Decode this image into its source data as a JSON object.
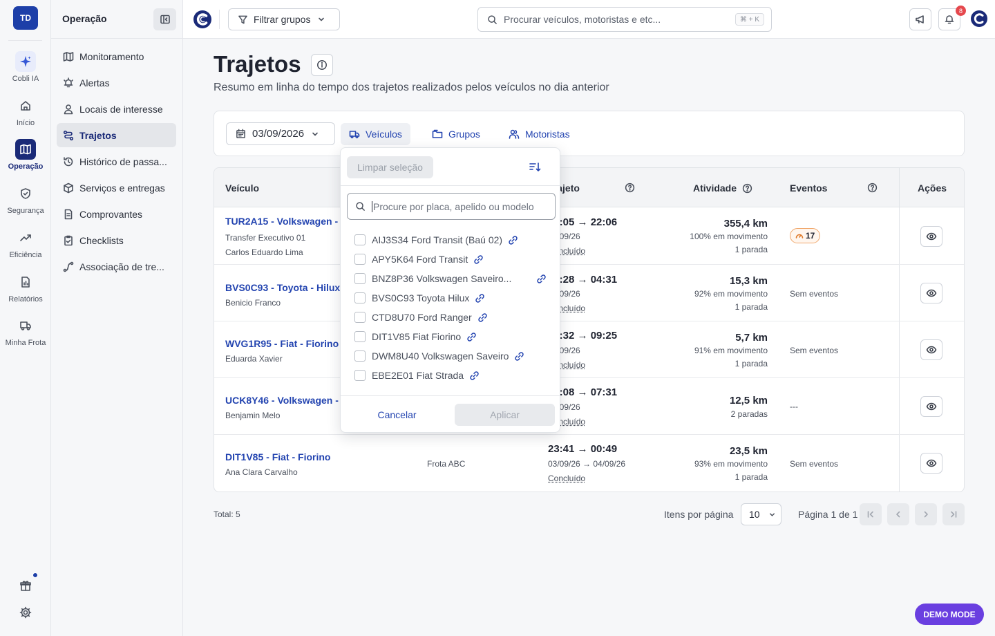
{
  "rail": {
    "avatar": "TD",
    "items": [
      {
        "label": "Cobli IA",
        "icon": "sparkles-icon"
      },
      {
        "label": "Início",
        "icon": "home-icon"
      },
      {
        "label": "Operação",
        "icon": "map-icon"
      },
      {
        "label": "Segurança",
        "icon": "shield-icon"
      },
      {
        "label": "Eficiência",
        "icon": "trend-icon"
      },
      {
        "label": "Relatórios",
        "icon": "report-icon"
      },
      {
        "label": "Minha Frota",
        "icon": "truck-icon"
      }
    ],
    "active": "Operação",
    "bottom": [
      "gift-icon",
      "gear-icon"
    ]
  },
  "sidebar": {
    "title": "Operação",
    "items": [
      {
        "label": "Monitoramento",
        "icon": "map-icon"
      },
      {
        "label": "Alertas",
        "icon": "bell-alert-icon"
      },
      {
        "label": "Locais de interesse",
        "icon": "place-icon"
      },
      {
        "label": "Trajetos",
        "icon": "route-icon",
        "active": true
      },
      {
        "label": "Histórico de passa...",
        "icon": "history-icon"
      },
      {
        "label": "Serviços e entregas",
        "icon": "package-icon"
      },
      {
        "label": "Comprovantes",
        "icon": "document-icon"
      },
      {
        "label": "Checklists",
        "icon": "checklist-icon"
      },
      {
        "label": "Associação de tre...",
        "icon": "link-route-icon"
      }
    ]
  },
  "topbar": {
    "filter_label": "Filtrar grupos",
    "search_placeholder": "Procurar veículos, motoristas e etc...",
    "search_shortcut": "⌘ + K",
    "notification_count": "8"
  },
  "page": {
    "title": "Trajetos",
    "subtitle": "Resumo em linha do tempo dos trajetos realizados pelos veículos no dia anterior"
  },
  "filters": {
    "date": "03/09/2026",
    "tabs": [
      "Veículos",
      "Grupos",
      "Motoristas"
    ],
    "selected_tab": "Veículos"
  },
  "table": {
    "headers": {
      "vehicle": "Veículo",
      "trip": "Trajeto",
      "activity": "Atividade",
      "events": "Eventos",
      "actions": "Ações"
    },
    "rows": [
      {
        "vehicle": "TUR2A15 - Volkswagen - Saveiro",
        "sub1": "Transfer Executivo 01",
        "sub2": "Carlos Eduardo Lima",
        "group": "",
        "time": "21:05 → 22:06",
        "date": "03/09/26",
        "status": "Concluído",
        "km": "355,4 km",
        "move": "100% em movimento",
        "stops": "1 parada",
        "events": "17",
        "events_type": "badge"
      },
      {
        "vehicle": "BVS0C93 - Toyota - Hilux",
        "sub1": "Benicio Franco",
        "sub2": "",
        "group": "",
        "time": "04:28 → 04:31",
        "date": "03/09/26",
        "status": "Concluído",
        "km": "15,3 km",
        "move": "92% em movimento",
        "stops": "1 parada",
        "events": "Sem eventos",
        "events_type": "text"
      },
      {
        "vehicle": "WVG1R95 - Fiat - Fiorino",
        "sub1": "Eduarda Xavier",
        "sub2": "",
        "group": "",
        "time": "09:32 → 09:25",
        "date": "03/09/26",
        "status": "Concluído",
        "km": "5,7 km",
        "move": "91% em movimento",
        "stops": "1 parada",
        "events": "Sem eventos",
        "events_type": "text"
      },
      {
        "vehicle": "UCK8Y46 - Volkswagen - Saveiro",
        "sub1": "Benjamin Melo",
        "sub2": "",
        "group": "",
        "time": "07:08 → 07:31",
        "date": "03/09/26",
        "status": "Concluído",
        "km": "12,5 km",
        "move": "",
        "stops": "2 paradas",
        "events": "---",
        "events_type": "text"
      },
      {
        "vehicle": "DIT1V85 - Fiat - Fiorino",
        "sub1": "Ana Clara Carvalho",
        "sub2": "",
        "group": "Frota ABC",
        "time": "23:41 → 00:49",
        "date": "03/09/26 → 04/09/26",
        "status": "Concluído",
        "km": "23,5 km",
        "move": "93% em movimento",
        "stops": "1 parada",
        "events": "Sem eventos",
        "events_type": "text"
      }
    ]
  },
  "pagination": {
    "total": "Total: 5",
    "items_per_page_label": "Itens por página",
    "items_per_page": "10",
    "page_label": "Página 1 de 1"
  },
  "vehicle_dropdown": {
    "clear_label": "Limpar seleção",
    "search_placeholder": "Procure por placa, apelido ou modelo",
    "options": [
      "AIJ3S34 Ford Transit (Baú 02)",
      "APY5K64 Ford Transit",
      "BNZ8P36 Volkswagen Saveiro...",
      "BVS0C93 Toyota Hilux",
      "CTD8U70 Ford Ranger",
      "DIT1V85 Fiat Fiorino",
      "DWM8U40 Volkswagen Saveiro",
      "EBE2E01 Fiat Strada"
    ],
    "cancel_label": "Cancelar",
    "apply_label": "Aplicar"
  },
  "demo_badge": "DEMO MODE",
  "colors": {
    "brand": "#1a2a78",
    "link": "#2344b0",
    "demo": "#6a3fe0",
    "notification": "#e5484d"
  }
}
